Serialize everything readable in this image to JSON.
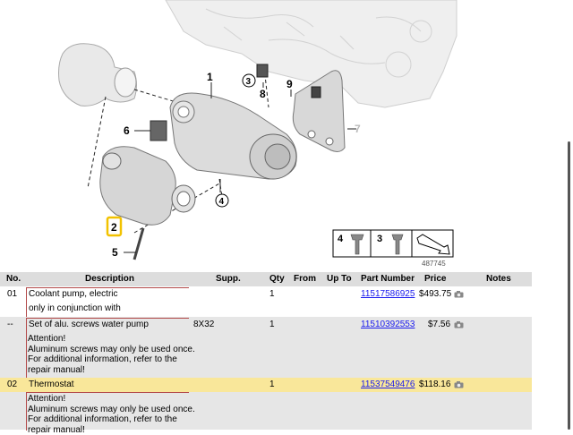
{
  "diagram": {
    "callouts": [
      "1",
      "2",
      "3",
      "4",
      "5",
      "6",
      "7",
      "8",
      "9"
    ],
    "legend_items": [
      "4",
      "3"
    ],
    "image_number": "487745"
  },
  "table": {
    "headers": {
      "no": "No.",
      "description": "Description",
      "supp": "Supp.",
      "qty": "Qty",
      "from": "From",
      "up_to": "Up To",
      "part_number": "Part Number",
      "price": "Price",
      "notes": "Notes"
    },
    "rows": [
      {
        "no": "01",
        "description": "Coolant pump, electric",
        "note": "only in conjunction with",
        "supp": "",
        "qty": "1",
        "part_number": "11517586925",
        "price": "$493.75"
      },
      {
        "no": "--",
        "description": "Set of alu. screws water pump",
        "note_lines": [
          "Attention!",
          "Aluminum screws may only be used once.",
          "For additional information, refer to the",
          "repair manual!"
        ],
        "supp": "8X32",
        "qty": "1",
        "part_number": "11510392553",
        "price": "$7.56"
      },
      {
        "no": "02",
        "description": "Thermostat",
        "note_lines": [
          "Attention!",
          "Aluminum screws may only be used once.",
          "For additional information, refer to the",
          "repair manual!"
        ],
        "supp": "",
        "qty": "1",
        "part_number": "11537549476",
        "price": "$118.16"
      }
    ]
  },
  "colors": {
    "highlight_row": "#f9e79a",
    "header_bg": "#dddddd",
    "link": "#1a1aee",
    "callout_highlight": "#f2c200"
  }
}
